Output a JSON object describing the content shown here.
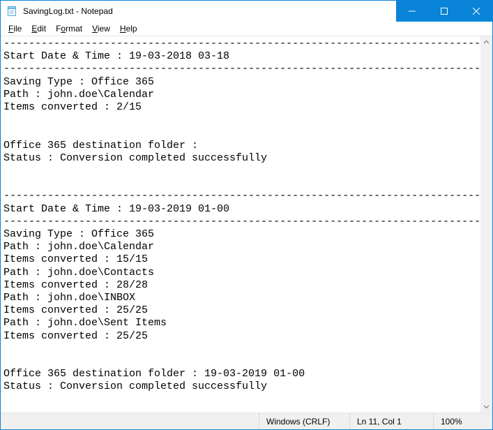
{
  "window": {
    "title": "SavingLog.txt - Notepad"
  },
  "menu": {
    "file": "File",
    "edit": "Edit",
    "format": "Format",
    "view": "View",
    "help": "Help"
  },
  "text": "-----------------------------------------------------------------------------\nStart Date & Time : 19-03-2018 03-18\n-----------------------------------------------------------------------------\nSaving Type : Office 365\nPath : john.doe\\Calendar\nItems converted : 2/15\n\n\nOffice 365 destination folder :\nStatus : Conversion completed successfully\n\n\n-----------------------------------------------------------------------------\nStart Date & Time : 19-03-2019 01-00\n-----------------------------------------------------------------------------\nSaving Type : Office 365\nPath : john.doe\\Calendar\nItems converted : 15/15\nPath : john.doe\\Contacts\nItems converted : 28/28\nPath : john.doe\\INBOX\nItems converted : 25/25\nPath : john.doe\\Sent Items\nItems converted : 25/25\n\n\nOffice 365 destination folder : 19-03-2019 01-00\nStatus : Conversion completed successfully",
  "status": {
    "encoding": "Windows (CRLF)",
    "position": "Ln 11, Col 1",
    "zoom": "100%"
  }
}
